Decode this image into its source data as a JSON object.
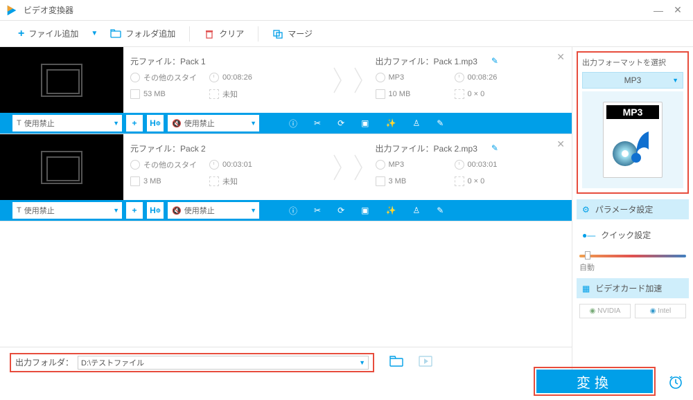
{
  "window": {
    "title": "ビデオ変換器"
  },
  "toolbar": {
    "add_file": "ファイル追加",
    "add_folder": "フォルダ追加",
    "clear": "クリア",
    "merge": "マージ"
  },
  "files": [
    {
      "src_label": "元ファイル：",
      "src_name": "Pack 1",
      "out_label": "出力ファイル：",
      "out_name": "Pack 1.mp3",
      "src_style": "その他のスタイ",
      "src_time": "00:08:26",
      "src_size": "53 MB",
      "src_dim": "未知",
      "out_fmt": "MP3",
      "out_time": "00:08:26",
      "out_size": "10 MB",
      "out_dim": "0 × 0",
      "dd1": "使用禁止",
      "dd2": "使用禁止"
    },
    {
      "src_label": "元ファイル：",
      "src_name": "Pack 2",
      "out_label": "出力ファイル：",
      "out_name": "Pack 2.mp3",
      "src_style": "その他のスタイ",
      "src_time": "00:03:01",
      "src_size": "3 MB",
      "src_dim": "未知",
      "out_fmt": "MP3",
      "out_time": "00:03:01",
      "out_size": "3 MB",
      "out_dim": "0 × 0",
      "dd1": "使用禁止",
      "dd2": "使用禁止"
    }
  ],
  "sidebar": {
    "format_title": "出力フォーマットを選択",
    "format_value": "MP3",
    "format_card": "MP3",
    "param": "パラメータ設定",
    "quick": "クイック設定",
    "auto": "自動",
    "gpu": "ビデオカード加速",
    "nvidia": "NVIDIA",
    "intel": "Intel"
  },
  "bottom": {
    "out_folder_label": "出力フォルダ：",
    "out_folder_value": "D:\\テストファイル",
    "convert": "変換"
  }
}
